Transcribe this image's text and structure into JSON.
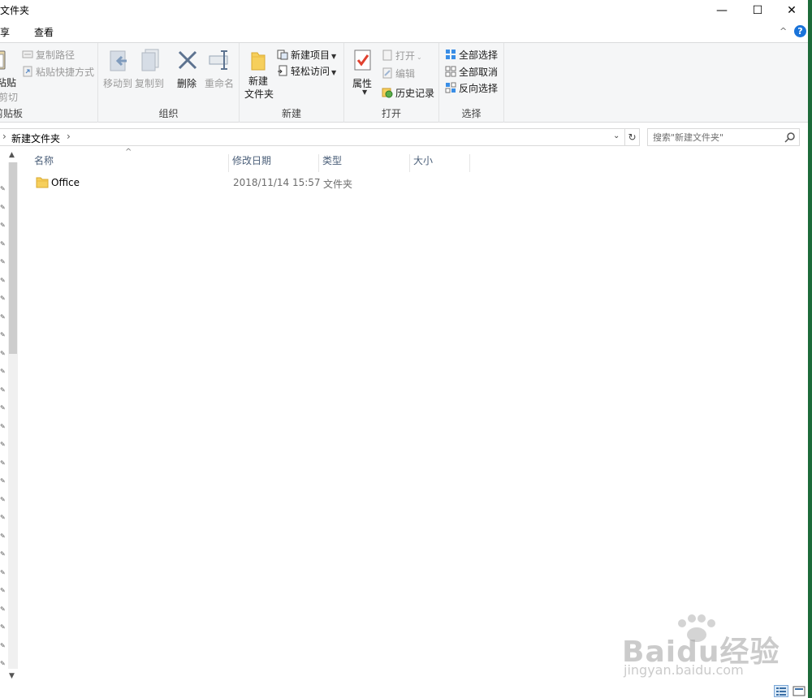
{
  "window": {
    "title": "建文件夹",
    "minimize_glyph": "—",
    "maximize_glyph": "☐",
    "close_glyph": "✕"
  },
  "ribbon_tabs": {
    "share": "共享",
    "view": "查看",
    "collapse_glyph": "^",
    "help_glyph": "?"
  },
  "ribbon": {
    "clipboard": {
      "paste": "粘贴",
      "copy_path": "复制路径",
      "paste_shortcut": "粘贴快捷方式",
      "cut": "剪切",
      "label": "剪贴板"
    },
    "organize": {
      "move_to": "移动到",
      "copy_to": "复制到",
      "delete": "删除",
      "rename": "重命名",
      "label": "组织"
    },
    "new": {
      "new_folder_line1": "新建",
      "new_folder_line2": "文件夹",
      "new_item": "新建项目",
      "easy_access": "轻松访问",
      "label": "新建"
    },
    "open": {
      "properties": "属性",
      "open": "打开",
      "edit": "编辑",
      "history": "历史记录",
      "label": "打开"
    },
    "select": {
      "select_all": "全部选择",
      "select_none": "全部取消",
      "invert": "反向选择",
      "label": "选择"
    }
  },
  "address": {
    "separator": "›",
    "crumb": "新建文件夹",
    "dropdown_glyph": "⌄",
    "refresh_glyph": "↻"
  },
  "search": {
    "placeholder": "搜索\"新建文件夹\""
  },
  "columns": {
    "name": "名称",
    "date": "修改日期",
    "type": "类型",
    "size": "大小",
    "sort_glyph": "^"
  },
  "files": [
    {
      "name": "Office",
      "date": "2018/11/14 15:57",
      "type": "文件夹",
      "size": ""
    }
  ],
  "watermark": {
    "brand": "Baidu经验",
    "url": "jingyan.baidu.com"
  },
  "colors": {
    "ribbon_bg": "#f5f6f7",
    "accent": "#1a73d9",
    "folder": "#f6cf5c",
    "column_header_text": "#4c607a"
  }
}
